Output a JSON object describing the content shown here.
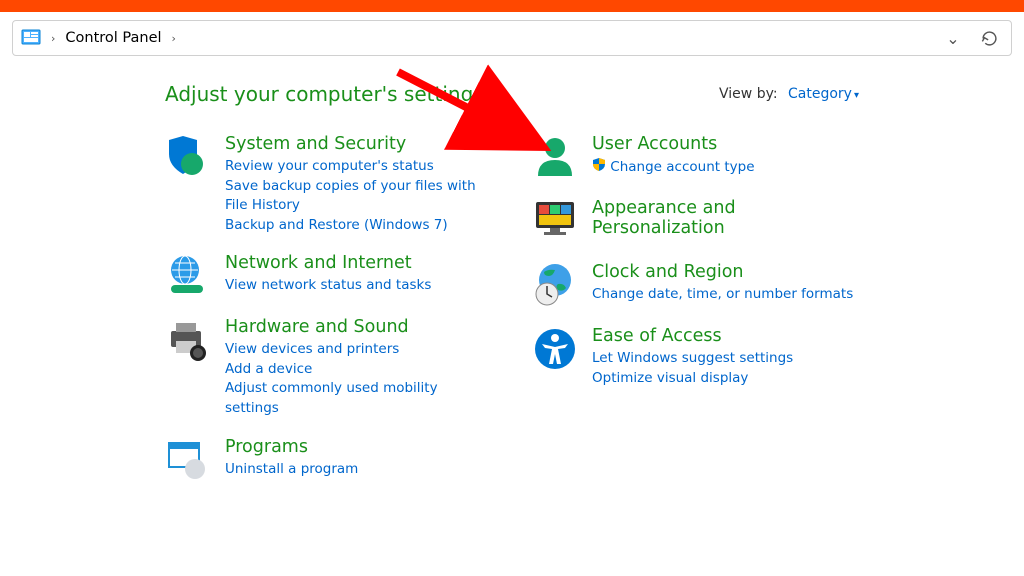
{
  "breadcrumb": {
    "item1": "Control Panel"
  },
  "page_title": "Adjust your computer's settings",
  "viewby": {
    "label": "View by:",
    "value": "Category"
  },
  "left": [
    {
      "title": "System and Security",
      "links": [
        "Review your computer's status",
        "Save backup copies of your files with File History",
        "Backup and Restore (Windows 7)"
      ]
    },
    {
      "title": "Network and Internet",
      "links": [
        "View network status and tasks"
      ]
    },
    {
      "title": "Hardware and Sound",
      "links": [
        "View devices and printers",
        "Add a device",
        "Adjust commonly used mobility settings"
      ]
    },
    {
      "title": "Programs",
      "links": [
        "Uninstall a program"
      ]
    }
  ],
  "right": [
    {
      "title": "User Accounts",
      "links": [
        "Change account type"
      ],
      "shield": true
    },
    {
      "title": "Appearance and Personalization",
      "links": []
    },
    {
      "title": "Clock and Region",
      "links": [
        "Change date, time, or number formats"
      ]
    },
    {
      "title": "Ease of Access",
      "links": [
        "Let Windows suggest settings",
        "Optimize visual display"
      ]
    }
  ]
}
